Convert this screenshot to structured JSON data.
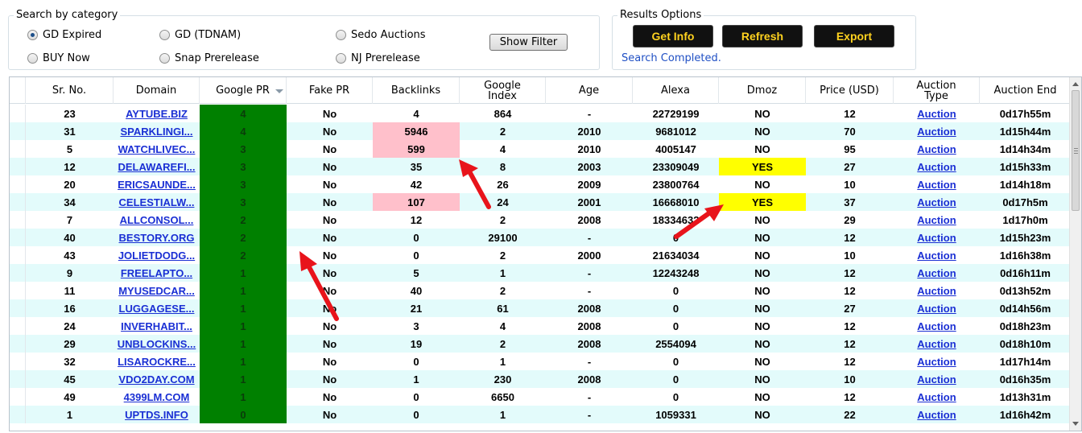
{
  "search_group": {
    "title": "Search by category",
    "options": [
      {
        "label": "GD Expired",
        "checked": true
      },
      {
        "label": "GD (TDNAM)",
        "checked": false
      },
      {
        "label": "Sedo Auctions",
        "checked": false
      },
      {
        "label": "BUY Now",
        "checked": false
      },
      {
        "label": "Snap Prerelease",
        "checked": false
      },
      {
        "label": "NJ Prerelease",
        "checked": false
      }
    ],
    "show_filter_label": "Show Filter"
  },
  "results_group": {
    "title": "Results Options",
    "get_info_label": "Get Info",
    "refresh_label": "Refresh",
    "export_label": "Export",
    "status": "Search Completed."
  },
  "colors": {
    "pr_fill": "#008000",
    "highlight_pink": "#ffc0cb",
    "highlight_yellow": "#ffff00",
    "row_alt": "#e3fbfb",
    "link": "#1a2fd4",
    "button_text": "#ffd21f",
    "arrow_red": "#e8141b"
  },
  "grid": {
    "sorted_column": "Google PR",
    "sort_direction": "descending",
    "columns": [
      "Sr. No.",
      "Domain",
      "Google PR",
      "Fake PR",
      "Backlinks",
      "Google Index",
      "Age",
      "Alexa",
      "Dmoz",
      "Price (USD)",
      "Auction Type",
      "Auction End"
    ],
    "rows": [
      {
        "sr": "23",
        "domain": "AYTUBE.BIZ",
        "pr": "4",
        "fake": "No",
        "backlinks": "4",
        "index": "864",
        "age": "-",
        "alexa": "22729199",
        "dmoz": "NO",
        "price": "12",
        "type": "Auction",
        "end": "0d17h55m",
        "hl_back": false,
        "hl_dmoz": false
      },
      {
        "sr": "31",
        "domain": "SPARKLINGI...",
        "pr": "4",
        "fake": "No",
        "backlinks": "5946",
        "index": "2",
        "age": "2010",
        "alexa": "9681012",
        "dmoz": "NO",
        "price": "70",
        "type": "Auction",
        "end": "1d15h44m",
        "hl_back": true,
        "hl_dmoz": false
      },
      {
        "sr": "5",
        "domain": "WATCHLIVEC...",
        "pr": "3",
        "fake": "No",
        "backlinks": "599",
        "index": "4",
        "age": "2010",
        "alexa": "4005147",
        "dmoz": "NO",
        "price": "95",
        "type": "Auction",
        "end": "1d14h34m",
        "hl_back": true,
        "hl_dmoz": false
      },
      {
        "sr": "12",
        "domain": "DELAWAREFI...",
        "pr": "3",
        "fake": "No",
        "backlinks": "35",
        "index": "8",
        "age": "2003",
        "alexa": "23309049",
        "dmoz": "YES",
        "price": "27",
        "type": "Auction",
        "end": "1d15h33m",
        "hl_back": false,
        "hl_dmoz": true
      },
      {
        "sr": "20",
        "domain": "ERICSAUNDE...",
        "pr": "3",
        "fake": "No",
        "backlinks": "42",
        "index": "26",
        "age": "2009",
        "alexa": "23800764",
        "dmoz": "NO",
        "price": "10",
        "type": "Auction",
        "end": "1d14h18m",
        "hl_back": false,
        "hl_dmoz": false
      },
      {
        "sr": "34",
        "domain": "CELESTIALW...",
        "pr": "3",
        "fake": "No",
        "backlinks": "107",
        "index": "24",
        "age": "2001",
        "alexa": "16668010",
        "dmoz": "YES",
        "price": "37",
        "type": "Auction",
        "end": "0d17h5m",
        "hl_back": true,
        "hl_dmoz": true
      },
      {
        "sr": "7",
        "domain": "ALLCONSOL...",
        "pr": "2",
        "fake": "No",
        "backlinks": "12",
        "index": "2",
        "age": "2008",
        "alexa": "18334632",
        "dmoz": "NO",
        "price": "29",
        "type": "Auction",
        "end": "1d17h0m",
        "hl_back": false,
        "hl_dmoz": false
      },
      {
        "sr": "40",
        "domain": "BESTORY.ORG",
        "pr": "2",
        "fake": "No",
        "backlinks": "0",
        "index": "29100",
        "age": "-",
        "alexa": "0",
        "dmoz": "NO",
        "price": "12",
        "type": "Auction",
        "end": "1d15h23m",
        "hl_back": false,
        "hl_dmoz": false
      },
      {
        "sr": "43",
        "domain": "JOLIETDODG...",
        "pr": "2",
        "fake": "No",
        "backlinks": "0",
        "index": "2",
        "age": "2000",
        "alexa": "21634034",
        "dmoz": "NO",
        "price": "10",
        "type": "Auction",
        "end": "1d16h38m",
        "hl_back": false,
        "hl_dmoz": false
      },
      {
        "sr": "9",
        "domain": "FREELAPTO...",
        "pr": "1",
        "fake": "No",
        "backlinks": "5",
        "index": "1",
        "age": "-",
        "alexa": "12243248",
        "dmoz": "NO",
        "price": "12",
        "type": "Auction",
        "end": "0d16h11m",
        "hl_back": false,
        "hl_dmoz": false
      },
      {
        "sr": "11",
        "domain": "MYUSEDCAR...",
        "pr": "1",
        "fake": "No",
        "backlinks": "40",
        "index": "2",
        "age": "-",
        "alexa": "0",
        "dmoz": "NO",
        "price": "12",
        "type": "Auction",
        "end": "0d13h52m",
        "hl_back": false,
        "hl_dmoz": false
      },
      {
        "sr": "16",
        "domain": "LUGGAGESE...",
        "pr": "1",
        "fake": "No",
        "backlinks": "21",
        "index": "61",
        "age": "2008",
        "alexa": "0",
        "dmoz": "NO",
        "price": "27",
        "type": "Auction",
        "end": "0d14h56m",
        "hl_back": false,
        "hl_dmoz": false
      },
      {
        "sr": "24",
        "domain": "INVERHABIT...",
        "pr": "1",
        "fake": "No",
        "backlinks": "3",
        "index": "4",
        "age": "2008",
        "alexa": "0",
        "dmoz": "NO",
        "price": "12",
        "type": "Auction",
        "end": "0d18h23m",
        "hl_back": false,
        "hl_dmoz": false
      },
      {
        "sr": "29",
        "domain": "UNBLOCKINS...",
        "pr": "1",
        "fake": "No",
        "backlinks": "19",
        "index": "2",
        "age": "2008",
        "alexa": "2554094",
        "dmoz": "NO",
        "price": "12",
        "type": "Auction",
        "end": "0d18h10m",
        "hl_back": false,
        "hl_dmoz": false
      },
      {
        "sr": "32",
        "domain": "LISAROCKRE...",
        "pr": "1",
        "fake": "No",
        "backlinks": "0",
        "index": "1",
        "age": "-",
        "alexa": "0",
        "dmoz": "NO",
        "price": "12",
        "type": "Auction",
        "end": "1d17h14m",
        "hl_back": false,
        "hl_dmoz": false
      },
      {
        "sr": "45",
        "domain": "VDO2DAY.COM",
        "pr": "1",
        "fake": "No",
        "backlinks": "1",
        "index": "230",
        "age": "2008",
        "alexa": "0",
        "dmoz": "NO",
        "price": "10",
        "type": "Auction",
        "end": "0d16h35m",
        "hl_back": false,
        "hl_dmoz": false
      },
      {
        "sr": "49",
        "domain": "4399LM.COM",
        "pr": "1",
        "fake": "No",
        "backlinks": "0",
        "index": "6650",
        "age": "-",
        "alexa": "0",
        "dmoz": "NO",
        "price": "12",
        "type": "Auction",
        "end": "1d13h31m",
        "hl_back": false,
        "hl_dmoz": false
      },
      {
        "sr": "1",
        "domain": "UPTDS.INFO",
        "pr": "0",
        "fake": "No",
        "backlinks": "0",
        "index": "1",
        "age": "-",
        "alexa": "1059331",
        "dmoz": "NO",
        "price": "22",
        "type": "Auction",
        "end": "1d16h42m",
        "hl_back": false,
        "hl_dmoz": false
      }
    ]
  }
}
